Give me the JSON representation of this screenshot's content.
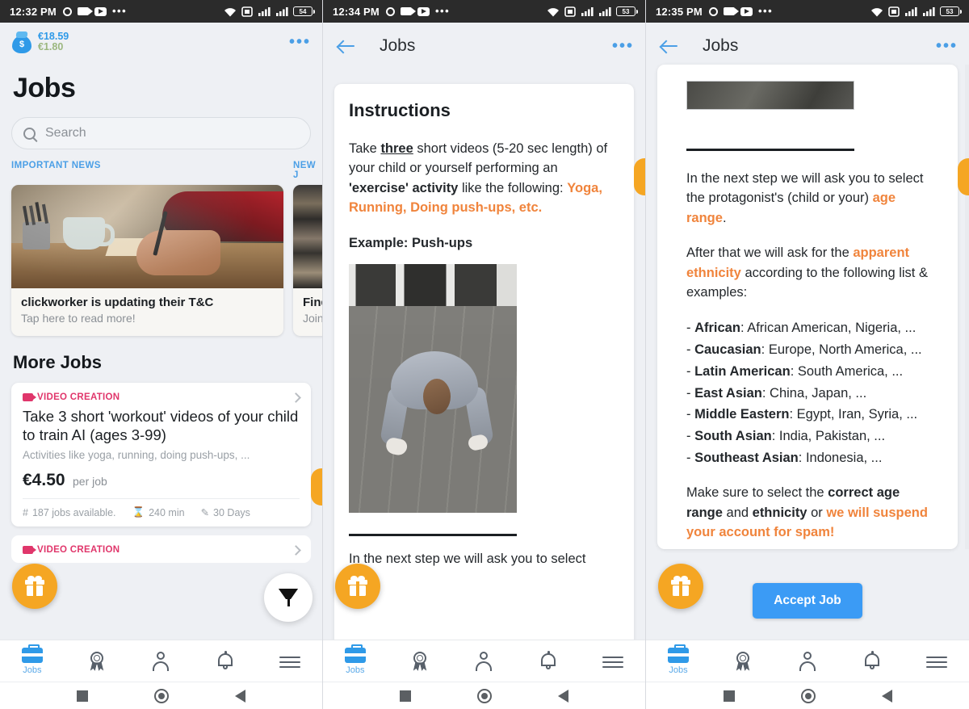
{
  "colors": {
    "accent_blue": "#4b9fe6",
    "button_blue": "#3b9bf5",
    "highlight_orange": "#f0843c",
    "fab_orange": "#f5a623",
    "category_pink": "#e0366b",
    "balance_green": "#9cb77f",
    "statusbar_bg": "#2b2b2b"
  },
  "screens": [
    {
      "status_bar": {
        "time": "12:32 PM",
        "left_icons": [
          "gear-icon",
          "video-camera-icon",
          "youtube-icon",
          "overflow-dots-icon"
        ],
        "right_icons": [
          "wifi-icon",
          "screenshot-icon",
          "signal-1-icon",
          "signal-2-icon"
        ],
        "battery": "54"
      },
      "wallet": {
        "icon": "money-bag-icon",
        "balance_main": "€18.59",
        "balance_secondary": "€1.80",
        "kebab": "•••"
      },
      "page_title": "Jobs",
      "search": {
        "placeholder": "Search",
        "icon": "search-icon"
      },
      "news": {
        "label_primary": "IMPORTANT NEWS",
        "label_secondary": "NEW J",
        "cards": [
          {
            "title": "clickworker is updating their T&C",
            "subtitle": "Tap here to read more!"
          },
          {
            "title": "Find",
            "subtitle": "Join"
          }
        ]
      },
      "more_jobs_heading": "More Jobs",
      "job_card": {
        "category": "VIDEO CREATION",
        "category_icon": "video-creation-icon",
        "chevron": "chevron-right-icon",
        "title": "Take 3 short 'workout' videos of your child to train AI (ages 3-99)",
        "description": "Activities like yoga, running, doing push-ups, ...",
        "price": "€4.50",
        "price_unit": "per job",
        "meta": [
          {
            "icon": "hash-icon",
            "text": "187 jobs available."
          },
          {
            "icon": "hourglass-icon",
            "text": "240 min"
          },
          {
            "icon": "calendar-icon",
            "text": "30 Days"
          }
        ]
      },
      "job_card_2": {
        "category": "VIDEO CREATION"
      },
      "fabs": [
        {
          "name": "gift-fab",
          "icon": "gift-icon"
        },
        {
          "name": "filter-fab",
          "icon": "funnel-icon"
        }
      ],
      "bottom_nav": [
        {
          "icon": "briefcase-icon",
          "label": "Jobs",
          "active": true
        },
        {
          "icon": "badge-icon",
          "label": "",
          "active": false
        },
        {
          "icon": "person-icon",
          "label": "",
          "active": false
        },
        {
          "icon": "bell-icon",
          "label": "",
          "active": false
        },
        {
          "icon": "hamburger-menu-icon",
          "label": "",
          "active": false
        }
      ],
      "system_nav": [
        "recents-square-icon",
        "home-circle-icon",
        "back-triangle-icon"
      ]
    },
    {
      "status_bar": {
        "time": "12:34 PM",
        "battery": "53"
      },
      "top_bar": {
        "back_icon": "back-arrow-icon",
        "title": "Jobs",
        "kebab": "•••"
      },
      "instructions": {
        "heading": "Instructions",
        "para1_a": "Take ",
        "para1_b": "three",
        "para1_c": " short videos (5-20 sec length) of your child or yourself performing an ",
        "para1_d": "'exercise' activity",
        "para1_e": " like the following: ",
        "para1_f": "Yoga, Running, Doing push-ups, etc.",
        "example_label": "Example: Push-ups",
        "image_alt": "push-up-demo-video",
        "next_step_cut": "In the next step we will ask you to select"
      },
      "fabs": [
        {
          "name": "gift-fab",
          "icon": "gift-icon"
        }
      ],
      "bottom_nav": [
        {
          "icon": "briefcase-icon",
          "label": "Jobs",
          "active": true
        },
        {
          "icon": "badge-icon",
          "label": "",
          "active": false
        },
        {
          "icon": "person-icon",
          "label": "",
          "active": false
        },
        {
          "icon": "bell-icon",
          "label": "",
          "active": false
        },
        {
          "icon": "hamburger-menu-icon",
          "label": "",
          "active": false
        }
      ]
    },
    {
      "status_bar": {
        "time": "12:35 PM",
        "battery": "53"
      },
      "top_bar": {
        "back_icon": "back-arrow-icon",
        "title": "Jobs",
        "kebab": "•••"
      },
      "details": {
        "para_next_a": "In the next step we will ask you to select the protagonist's (child or your) ",
        "para_next_b": "age range",
        "para_next_c": ".",
        "para_after_a": "After that we will ask for the ",
        "para_after_b": "apparent ethnicity",
        "para_after_c": " according to the following list & examples:",
        "ethnicities": [
          {
            "name": "African",
            "examples": "African American, Nigeria, ..."
          },
          {
            "name": "Caucasian",
            "examples": "Europe, North America, ..."
          },
          {
            "name": "Latin American",
            "examples": "South America, ..."
          },
          {
            "name": "East Asian",
            "examples": "China, Japan, ..."
          },
          {
            "name": "Middle Eastern",
            "examples": "Egypt, Iran, Syria, ..."
          },
          {
            "name": "South Asian",
            "examples": "India, Pakistan, ..."
          },
          {
            "name": "Southeast Asian",
            "examples": "Indonesia, ..."
          }
        ],
        "warn_a": "Make sure to select the ",
        "warn_b": "correct age range",
        "warn_c": " and ",
        "warn_d": "ethnicity",
        "warn_e": " or ",
        "warn_f": "we will suspend your account for spam!"
      },
      "accept_button": "Accept Job",
      "fabs": [
        {
          "name": "gift-fab",
          "icon": "gift-icon"
        }
      ],
      "bottom_nav": [
        {
          "icon": "briefcase-icon",
          "label": "Jobs",
          "active": true
        },
        {
          "icon": "badge-icon",
          "label": "",
          "active": false
        },
        {
          "icon": "person-icon",
          "label": "",
          "active": false
        },
        {
          "icon": "bell-icon",
          "label": "",
          "active": false
        },
        {
          "icon": "hamburger-menu-icon",
          "label": "",
          "active": false
        }
      ]
    }
  ]
}
